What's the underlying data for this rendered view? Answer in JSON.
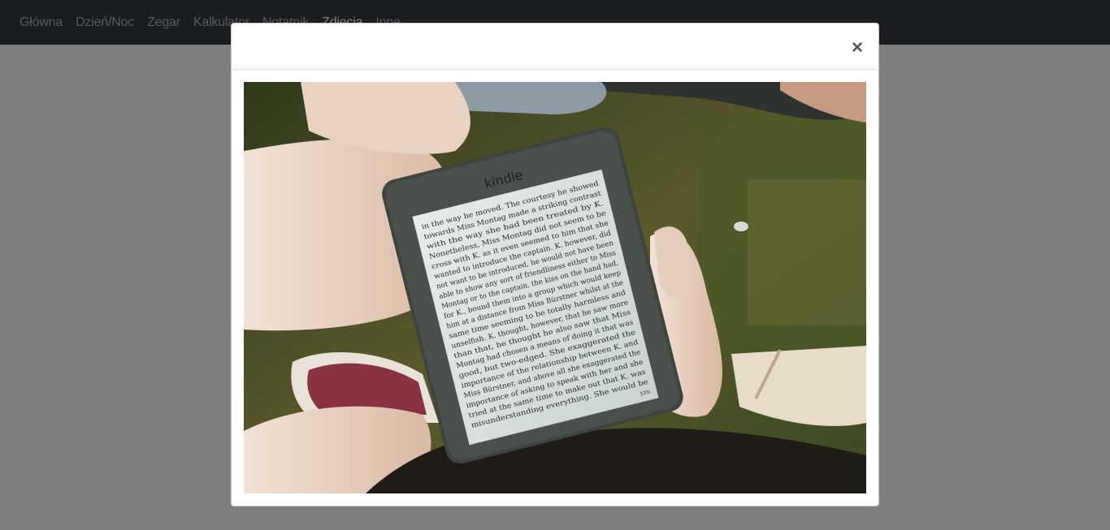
{
  "nav": {
    "items": [
      {
        "label": "Główna",
        "active": false
      },
      {
        "label": "Dzień/Noc",
        "active": false
      },
      {
        "label": "Zegar",
        "active": false
      },
      {
        "label": "Kalkulator",
        "active": false
      },
      {
        "label": "Notatnik",
        "active": false
      },
      {
        "label": "Zdjęcia",
        "active": true
      },
      {
        "label": "Inne",
        "active": false
      }
    ]
  },
  "modal": {
    "close_label": "×",
    "photo": {
      "device_brand": "kindle",
      "page_percent": "33%",
      "text_lines": [
        "in the way he moved. The courtesy he showed",
        "towards Miss Montag made a striking contrast",
        "with the way she had been treated by K.",
        "Nonetheless, Miss Montag did not seem to be",
        "cross with K. as it even seemed to him that she",
        "wanted to introduce the captain. K. however, did",
        "not want to be introduced, he would not have been",
        "able to show any sort of friendliness either to Miss",
        "Montag or to the captain, the kiss on the hand had,",
        "for K., bound them into a group which would keep",
        "him at a distance from Miss Bürstner whilst at the",
        "same time seeming to be totally harmless and",
        "unselfish. K. thought, however, that he saw more",
        "than that, he thought he also saw that Miss",
        "Montag had chosen a means of doing it that was",
        "good, but two-edged. She exaggerated the",
        "importance of the relationship between K. and",
        "Miss Bürstner, and above all she exaggerated the",
        "importance of asking to speak with her and she",
        "tried at the same time to make out that K. was",
        "misunderstanding everything. She would be"
      ]
    }
  },
  "colors": {
    "navbar_bg": "#343a40",
    "backdrop": "rgba(0,0,0,0.5)",
    "modal_bg": "#ffffff"
  }
}
